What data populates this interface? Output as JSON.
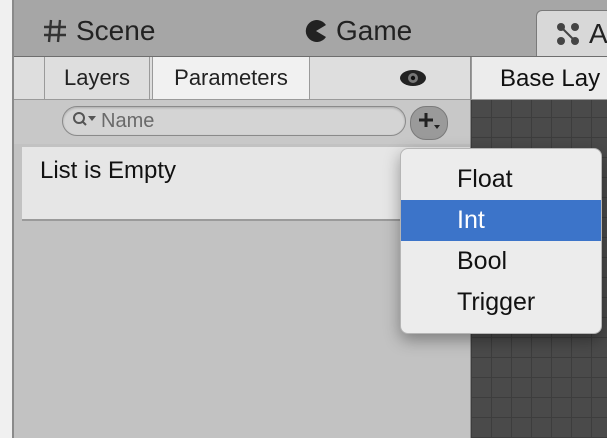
{
  "tabs": {
    "scene": "Scene",
    "game": "Game",
    "animator": "A"
  },
  "subtabs": {
    "layers": "Layers",
    "parameters": "Parameters"
  },
  "search": {
    "placeholder": "Name"
  },
  "list": {
    "empty_text": "List is Empty"
  },
  "graph": {
    "layer_label": "Base Lay"
  },
  "menu": {
    "items": [
      {
        "label": "Float",
        "selected": false
      },
      {
        "label": "Int",
        "selected": true
      },
      {
        "label": "Bool",
        "selected": false
      },
      {
        "label": "Trigger",
        "selected": false
      }
    ]
  },
  "colors": {
    "selection": "#3c74c9",
    "graph_bg": "#4a4a4a",
    "panel_bg": "#c2c2c2"
  },
  "icons": {
    "scene": "grid-hash-icon",
    "game": "pacman-icon",
    "animator": "animator-icon",
    "eye": "eye-icon",
    "search": "search-dropdown-icon",
    "add": "plus-dropdown-icon"
  }
}
